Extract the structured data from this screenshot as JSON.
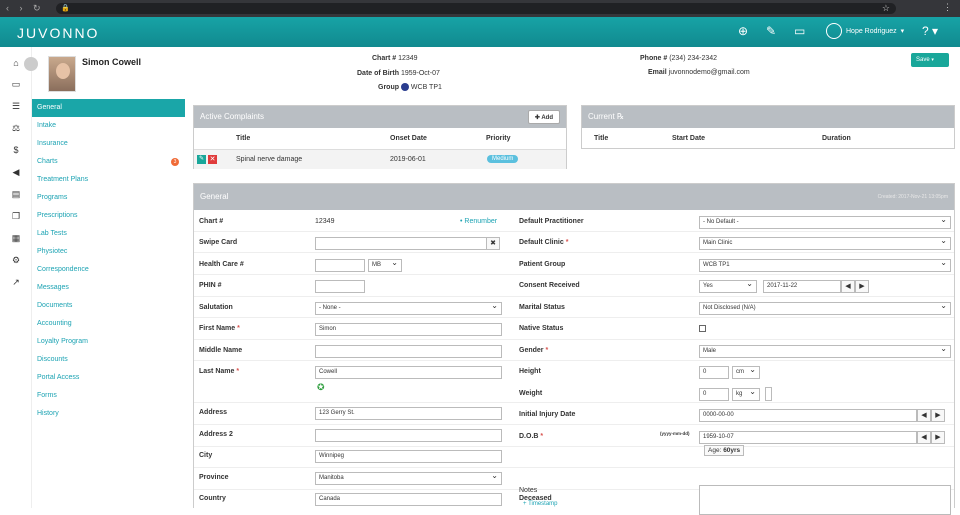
{
  "topbar": {
    "logo": "JUVONNO",
    "user_name": "Hope Rodriguez"
  },
  "patient": {
    "name": "Simon Cowell",
    "chart_label": "Chart #",
    "chart_value": "12349",
    "dob_label": "Date of Birth",
    "dob_value": "1959-Oct-07",
    "group_label": "Group",
    "group_value": "WCB TP1",
    "phone_label": "Phone #",
    "phone_value": "(234) 234-2342",
    "email_label": "Email",
    "email_value": "juvonnodemo@gmail.com",
    "save_label": "Save"
  },
  "sidemenu": [
    {
      "label": "General"
    },
    {
      "label": "Intake"
    },
    {
      "label": "Insurance"
    },
    {
      "label": "Charts",
      "badge": "3"
    },
    {
      "label": "Treatment Plans"
    },
    {
      "label": "Programs"
    },
    {
      "label": "Prescriptions"
    },
    {
      "label": "Lab Tests"
    },
    {
      "label": "Physiotec"
    },
    {
      "label": "Correspondence"
    },
    {
      "label": "Messages"
    },
    {
      "label": "Documents"
    },
    {
      "label": "Accounting"
    },
    {
      "label": "Loyalty Program"
    },
    {
      "label": "Discounts"
    },
    {
      "label": "Portal Access"
    },
    {
      "label": "Forms"
    },
    {
      "label": "History"
    }
  ],
  "complaints": {
    "title": "Active Complaints",
    "add_label": "Add",
    "headers": [
      "Title",
      "Onset Date",
      "Priority"
    ],
    "rows": [
      {
        "title": "Spinal nerve damage",
        "onset": "2019-06-01",
        "priority": "Medium"
      }
    ]
  },
  "current": {
    "title": "Current ℞",
    "headers": [
      "Title",
      "Start Date",
      "Duration"
    ]
  },
  "general": {
    "title": "General",
    "meta": "Created: 2017-Nov-21 13:05pm",
    "chart_label": "Chart #",
    "chart_value": "12349",
    "renumber": "Renumber",
    "swipe_label": "Swipe Card",
    "healthcare_label": "Health Care #",
    "healthcare_prov": "MB",
    "phin_label": "PHIN #",
    "salutation_label": "Salutation",
    "salutation_value": "- None -",
    "first_label": "First Name",
    "first_value": "Simon",
    "middle_label": "Middle Name",
    "last_label": "Last Name",
    "last_value": "Cowell",
    "address_label": "Address",
    "address_value": "123 Gerry St.",
    "address2_label": "Address 2",
    "city_label": "City",
    "city_value": "Winnipeg",
    "province_label": "Province",
    "province_value": "Manitoba",
    "country_label": "Country",
    "country_value": "Canada",
    "practitioner_label": "Default Practitioner",
    "practitioner_value": "- No Default -",
    "clinic_label": "Default Clinic",
    "clinic_value": "Main Clinic",
    "pgroup_label": "Patient Group",
    "pgroup_value": "WCB TP1",
    "consent_label": "Consent Received",
    "consent_value": "Yes",
    "consent_date": "2017-11-22",
    "marital_label": "Marital Status",
    "marital_value": "Not Disclosed (N/A)",
    "native_label": "Native Status",
    "gender_label": "Gender",
    "gender_value": "Male",
    "height_label": "Height",
    "height_value": "0",
    "height_unit": "cm",
    "weight_label": "Weight",
    "weight_value": "0",
    "weight_unit": "kg",
    "injury_label": "Initial Injury Date",
    "injury_value": "0000-00-00",
    "dob_label": "D.O.B",
    "dob_hint": "(yyyy-mm-dd)",
    "dob_value": "1959-10-07",
    "age_label": "Age:",
    "age_value": "60yrs",
    "deceased_label": "Deceased",
    "notes_label": "Notes",
    "timestamp": "+ Timestamp"
  }
}
